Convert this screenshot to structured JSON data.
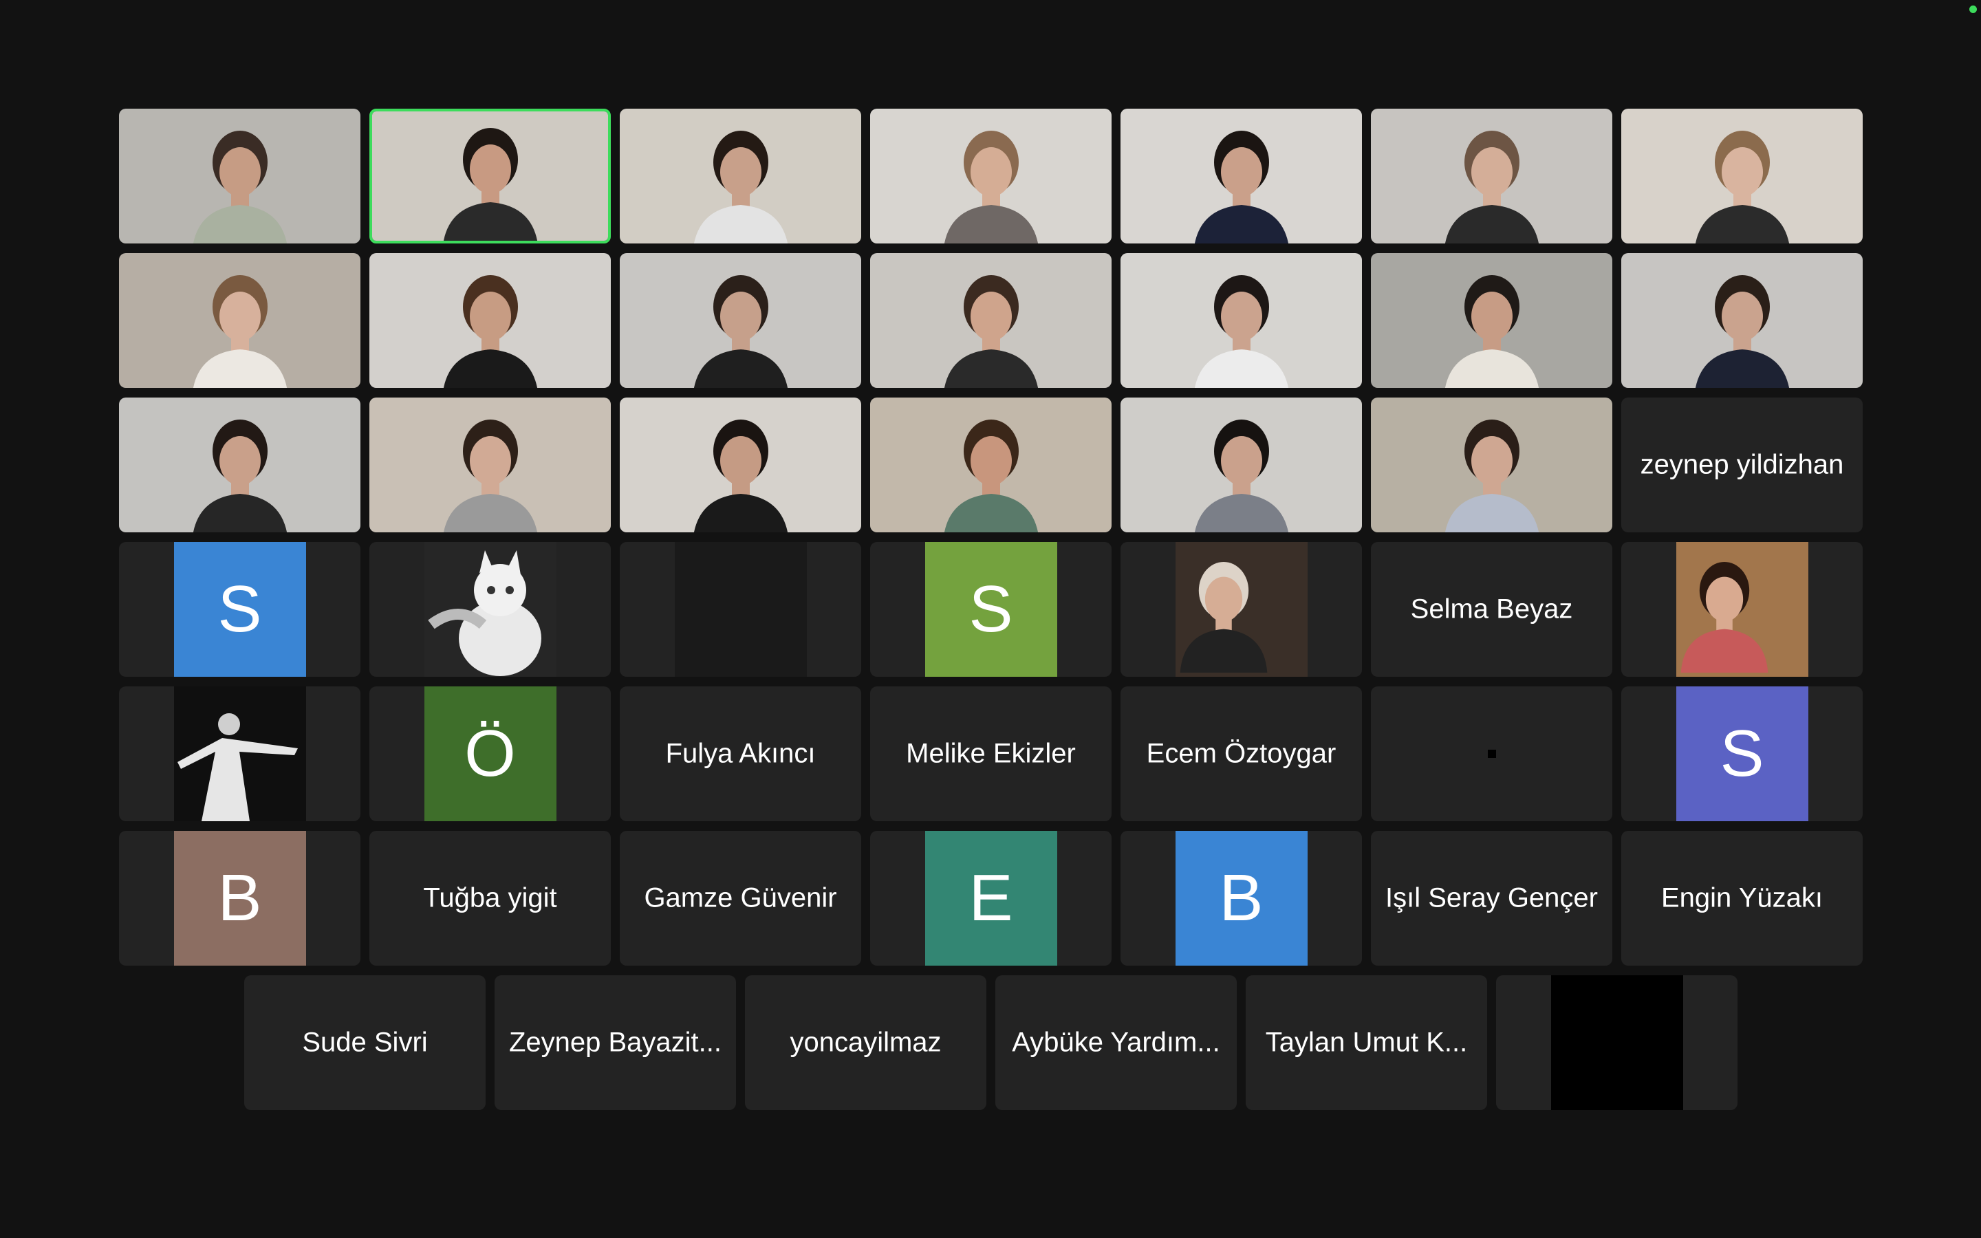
{
  "colors": {
    "background": "#121212",
    "tile": "#232323",
    "speaking_border": "#3ddc5c",
    "status_dot": "#3ddc5c"
  },
  "video_participants": [
    {
      "id": "v1",
      "bg": "#b8b6b1",
      "skin": "#c69c84",
      "hair": "#3a2c25",
      "shirt": "#a9b1a0"
    },
    {
      "id": "v2",
      "bg": "#cfcac2",
      "skin": "#c89a82",
      "hair": "#1e1713",
      "shirt": "#2a2a2a",
      "speaking": true
    },
    {
      "id": "v3",
      "bg": "#d2cdc4",
      "skin": "#c8a08a",
      "hair": "#241a14",
      "shirt": "#e3e3e3"
    },
    {
      "id": "v4",
      "bg": "#d8d5d0",
      "skin": "#d5ad95",
      "hair": "#8a6a50",
      "shirt": "#6f6865"
    },
    {
      "id": "v5",
      "bg": "#d9d6d2",
      "skin": "#caa08a",
      "hair": "#1b1512",
      "shirt": "#1c2238"
    },
    {
      "id": "v6",
      "bg": "#c7c4c0",
      "skin": "#d4ae98",
      "hair": "#6d5544",
      "shirt": "#2a2a2a"
    },
    {
      "id": "v7",
      "bg": "#d8d2ca",
      "skin": "#d9b49f",
      "hair": "#8b6b4d",
      "shirt": "#2b2b2b"
    },
    {
      "id": "v8",
      "bg": "#b6aea4",
      "skin": "#d7b19c",
      "hair": "#7a5a40",
      "shirt": "#ece8e2"
    },
    {
      "id": "v9",
      "bg": "#d3d0cc",
      "skin": "#c79c83",
      "hair": "#4a3020",
      "shirt": "#1a1a1a"
    },
    {
      "id": "v10",
      "bg": "#c8c6c3",
      "skin": "#c6a08b",
      "hair": "#2b201a",
      "shirt": "#1f1f1f"
    },
    {
      "id": "v11",
      "bg": "#c9c6c1",
      "skin": "#cfa48c",
      "hair": "#3b2a20",
      "shirt": "#2a2a2a"
    },
    {
      "id": "v12",
      "bg": "#d6d4d0",
      "skin": "#cba38e",
      "hair": "#1d1715",
      "shirt": "#ececec"
    },
    {
      "id": "v13",
      "bg": "#a8a7a2",
      "skin": "#c79c85",
      "hair": "#1f1a17",
      "shirt": "#e8e4dc"
    },
    {
      "id": "v14",
      "bg": "#c7c5c2",
      "skin": "#caa38e",
      "hair": "#2a1f18",
      "shirt": "#1d2233"
    },
    {
      "id": "v15",
      "bg": "#c4c3c0",
      "skin": "#c9a08a",
      "hair": "#221915",
      "shirt": "#262626"
    },
    {
      "id": "v16",
      "bg": "#c9c0b5",
      "skin": "#d1aa95",
      "hair": "#2d2018",
      "shirt": "#9a9a9a"
    },
    {
      "id": "v17",
      "bg": "#d6d2cc",
      "skin": "#c59b84",
      "hair": "#1a1411",
      "shirt": "#1a1a1a"
    },
    {
      "id": "v18",
      "bg": "#c2b8aa",
      "skin": "#c8967d",
      "hair": "#3b2719",
      "shirt": "#5a7a6a"
    },
    {
      "id": "v19",
      "bg": "#cfcdc9",
      "skin": "#caa18c",
      "hair": "#161210",
      "shirt": "#7b7f88"
    },
    {
      "id": "v20",
      "bg": "#b7b0a3",
      "skin": "#cfa792",
      "hair": "#2a1e18",
      "shirt": "#b5bccb"
    }
  ],
  "name_labels": {
    "zeynep": "zeynep yildizhan",
    "selma": "Selma Beyaz",
    "fulya": "Fulya Akıncı",
    "melike": "Melike Ekizler",
    "ecem": "Ecem Öztoygar",
    "tugba": "Tuğba yigit",
    "gamze": "Gamze Güvenir",
    "isil": "Işıl Seray Gençer",
    "engin": "Engin Yüzakı",
    "sude": "Sude Sivri",
    "zeynepb": "Zeynep Bayazit...",
    "yonca": "yoncayilmaz",
    "aybuke": "Aybüke Yardım...",
    "taylan": "Taylan Umut K..."
  },
  "avatars": {
    "s1": {
      "letter": "S",
      "color": "#3a85d4"
    },
    "s2": {
      "letter": "S",
      "color": "#74a23e"
    },
    "o1": {
      "letter": "Ö",
      "color": "#3e6e2a"
    },
    "s3": {
      "letter": "S",
      "color": "#5b62c4"
    },
    "b1": {
      "letter": "B",
      "color": "#8c6e62"
    },
    "e1": {
      "letter": "E",
      "color": "#338673"
    },
    "b2": {
      "letter": "B",
      "color": "#3a85d4"
    }
  },
  "photo_tiles": {
    "cat": {
      "bg": "#2a2a2a"
    },
    "hijab": {
      "bg": "#3a2f28"
    },
    "smile": {
      "bg": "#a2764c"
    },
    "dancer": {
      "bg": "#111111"
    }
  }
}
